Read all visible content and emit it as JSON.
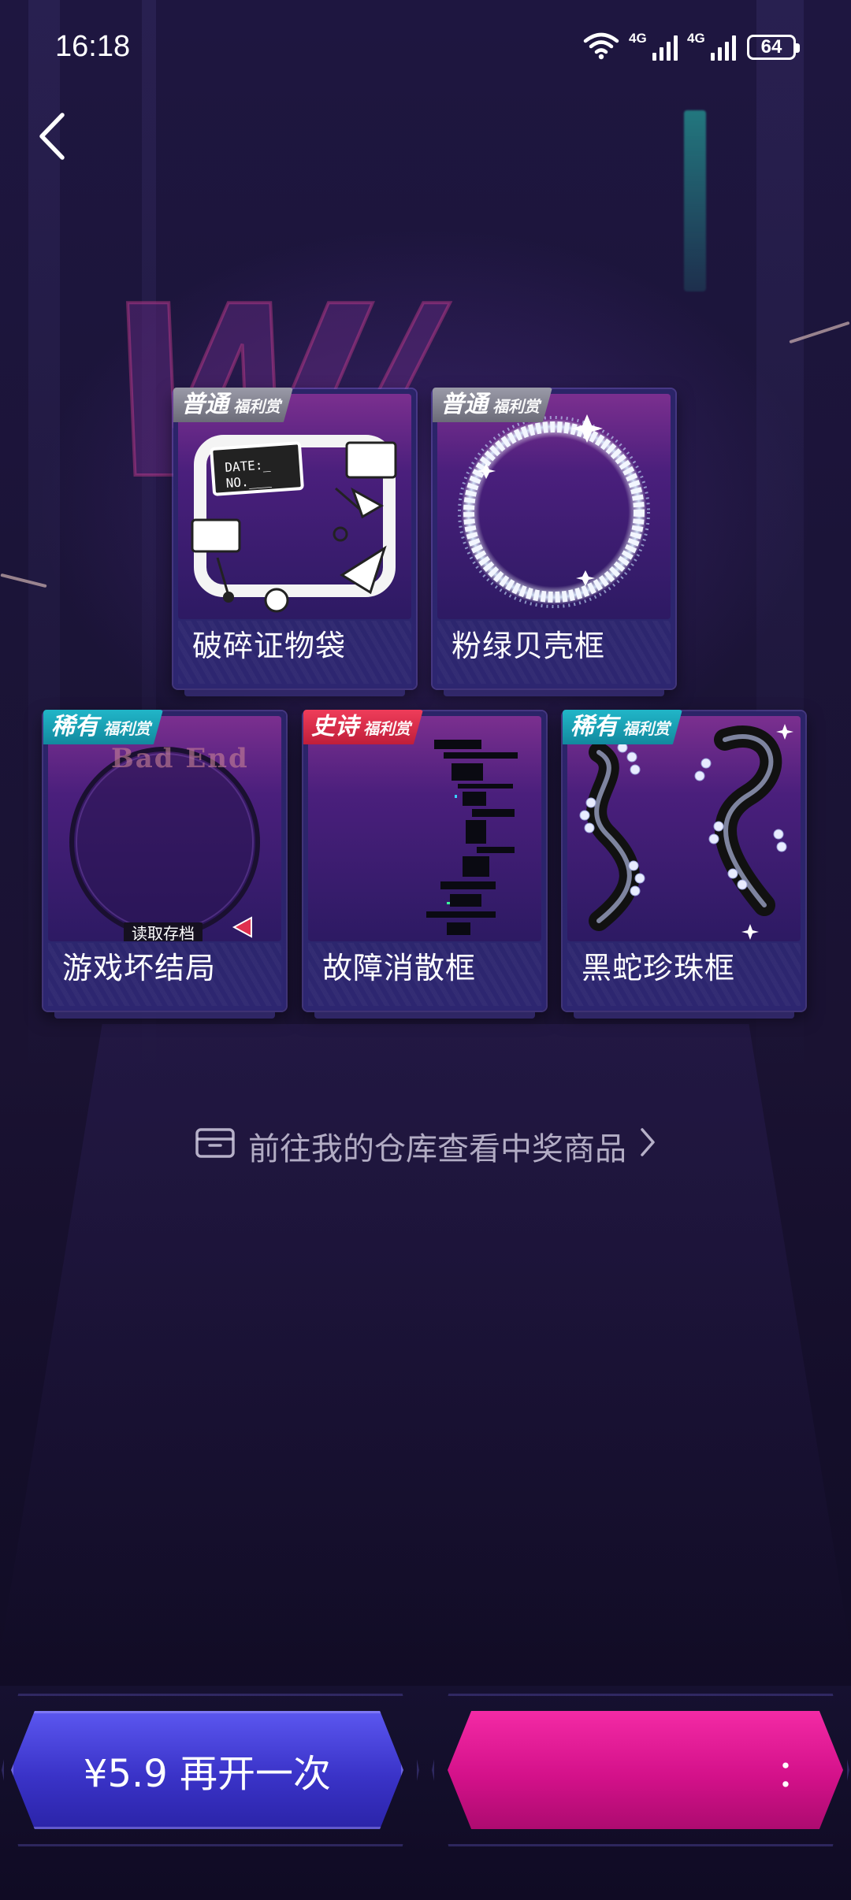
{
  "status_bar": {
    "time": "16:18",
    "signal_1_label": "4G",
    "signal_2_label": "4G",
    "battery": "64"
  },
  "back_icon": "chevron-left-icon",
  "cards": [
    {
      "tier": "普通",
      "sub": "福利赏",
      "tier_color": "#8a8a96",
      "name": "破碎证物袋",
      "art_text_1": "DATE:_",
      "art_text_2": "NO.___"
    },
    {
      "tier": "普通",
      "sub": "福利赏",
      "tier_color": "#8a8a96",
      "name": "粉绿贝壳框"
    },
    {
      "tier": "稀有",
      "sub": "福利赏",
      "tier_color": "#1aa3b6",
      "name": "游戏坏结局",
      "art_text_1": "Bad End",
      "art_text_2": "读取存档"
    },
    {
      "tier": "史诗",
      "sub": "福利赏",
      "tier_color": "#e0304e",
      "name": "故障消散框"
    },
    {
      "tier": "稀有",
      "sub": "福利赏",
      "tier_color": "#1aa3b6",
      "name": "黑蛇珍珠框"
    }
  ],
  "warehouse_link": {
    "label": "前往我的仓库查看中奖商品",
    "icon": "box-icon",
    "arrow_icon": "chevron-right-icon"
  },
  "buttons": {
    "reopen_label": "¥5.9 再开一次",
    "right_label": "："
  },
  "colors": {
    "reopen_button": "#4a44e0",
    "right_button": "#e81c98",
    "background": "#1a1232"
  }
}
